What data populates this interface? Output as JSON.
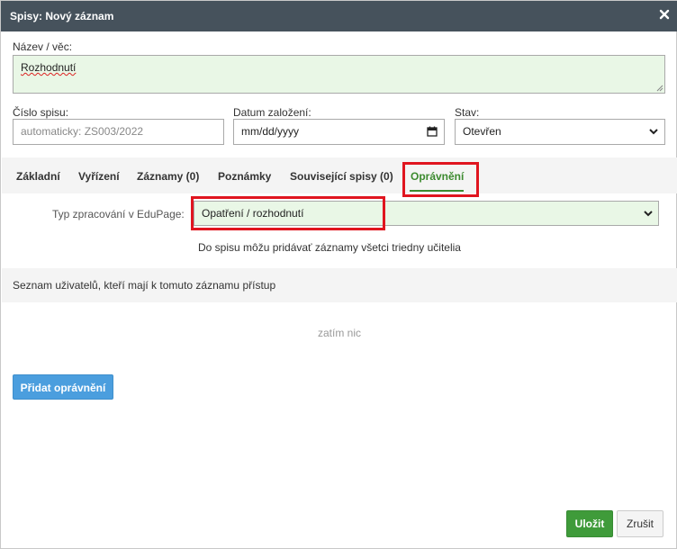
{
  "dialog": {
    "title": "Spisy: Nový záznam",
    "close_icon": "close-icon"
  },
  "form": {
    "name_label": "Název / věc:",
    "name_value": "Rozhodnutí",
    "file_number_label": "Číslo spisu:",
    "file_number_placeholder": "automaticky: ZS003/2022",
    "date_label": "Datum založení:",
    "date_placeholder": "mm/dd/yyyy",
    "status_label": "Stav:",
    "status_value": "Otevřen"
  },
  "tabs": [
    {
      "label": "Základní",
      "active": false
    },
    {
      "label": "Vyřízení",
      "active": false
    },
    {
      "label": "Záznamy (0)",
      "active": false
    },
    {
      "label": "Poznámky",
      "active": false
    },
    {
      "label": "Související spisy (0)",
      "active": false
    },
    {
      "label": "Oprávnění",
      "active": true
    }
  ],
  "permissions": {
    "type_label": "Typ zpracování v EduPage:",
    "type_value": "Opatření / rozhodnutí",
    "type_hint": "Do spisu môžu pridávať záznamy všetci triedny učitelia",
    "users_heading": "Seznam uživatelů, kteří mají k tomuto záznamu přístup",
    "empty_text": "zatím nic",
    "add_button": "Přidat oprávnění"
  },
  "footer": {
    "save_button": "Uložit",
    "cancel_button": "Zrušit"
  },
  "colors": {
    "titlebar": "#46525c",
    "active_tab": "#3c8a2f",
    "highlight": "#e0151f",
    "primary_button": "#4b9ede",
    "save_button": "#3f9b3a",
    "field_green": "#e9f7e6"
  }
}
